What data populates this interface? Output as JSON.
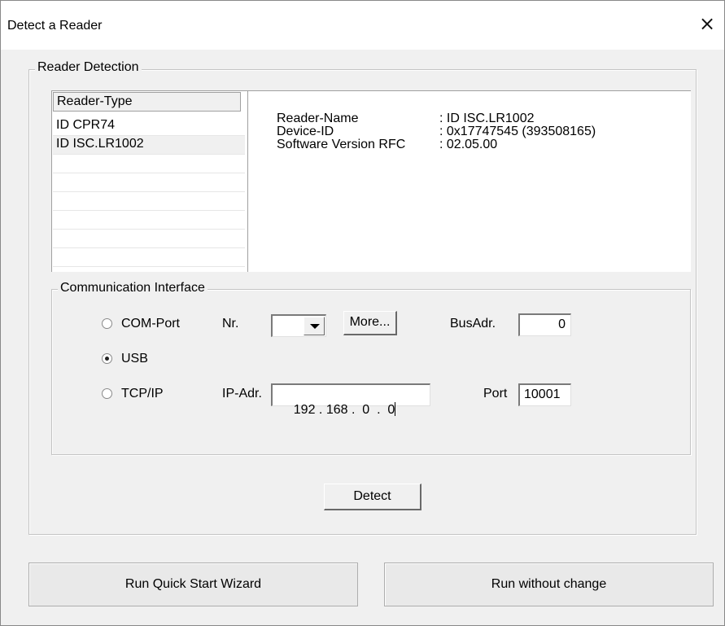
{
  "window": {
    "title": "Detect a Reader",
    "close_glyph": "×"
  },
  "reader_detection": {
    "label": "Reader Detection",
    "list": {
      "header": "Reader-Type",
      "items": [
        {
          "label": "ID CPR74",
          "selected": false
        },
        {
          "label": "ID ISC.LR1002",
          "selected": true
        },
        {
          "label": ""
        },
        {
          "label": ""
        },
        {
          "label": ""
        },
        {
          "label": ""
        },
        {
          "label": ""
        },
        {
          "label": ""
        }
      ]
    },
    "info": {
      "rows": [
        {
          "label": "Reader-Name",
          "value": ": ID ISC.LR1002"
        },
        {
          "label": "Device-ID",
          "value": ": 0x17747545 (393508165)"
        },
        {
          "label": "Software Version RFC",
          "value": ": 02.05.00"
        }
      ]
    }
  },
  "communication_interface": {
    "label": "Communication Interface",
    "com_port": {
      "label": "COM-Port",
      "selected": false,
      "nr_label": "Nr.",
      "nr_value": "",
      "more_label": "More...",
      "busadr_label": "BusAdr.",
      "busadr_value": "0"
    },
    "usb": {
      "label": "USB",
      "selected": true
    },
    "tcpip": {
      "label": "TCP/IP",
      "selected": false,
      "ip_label": "IP-Adr.",
      "ip_value": "192 . 168 .  0  .  0",
      "port_label": "Port",
      "port_value": "10001"
    }
  },
  "detect_button": "Detect",
  "footer": {
    "wizard_button": "Run Quick Start Wizard",
    "run_button": "Run without change"
  }
}
